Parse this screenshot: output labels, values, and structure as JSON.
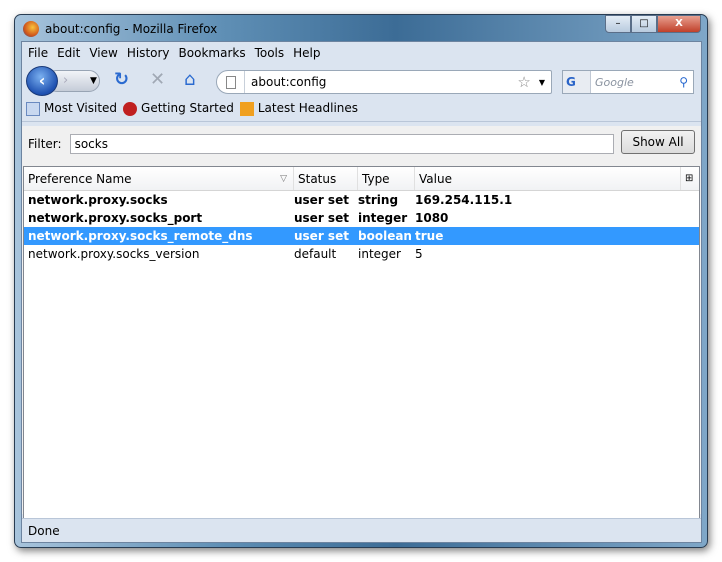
{
  "window": {
    "title": "about:config - Mozilla Firefox",
    "minimize": "–",
    "maximize": "□",
    "close": "X"
  },
  "menu": [
    "File",
    "Edit",
    "View",
    "History",
    "Bookmarks",
    "Tools",
    "Help"
  ],
  "nav": {
    "url": "about:config",
    "search_engine": "G",
    "search_placeholder": "Google"
  },
  "bookmarks": [
    "Most Visited",
    "Getting Started",
    "Latest Headlines"
  ],
  "filter": {
    "label": "Filter:",
    "value": "socks",
    "show_all": "Show All"
  },
  "columns": [
    "Preference Name",
    "Status",
    "Type",
    "Value"
  ],
  "rows": [
    {
      "name": "network.proxy.socks",
      "status": "user set",
      "type": "string",
      "value": "169.254.115.1",
      "style": "bold"
    },
    {
      "name": "network.proxy.socks_port",
      "status": "user set",
      "type": "integer",
      "value": "1080",
      "style": "bold"
    },
    {
      "name": "network.proxy.socks_remote_dns",
      "status": "user set",
      "type": "boolean",
      "value": "true",
      "style": "sel"
    },
    {
      "name": "network.proxy.socks_version",
      "status": "default",
      "type": "integer",
      "value": "5",
      "style": ""
    }
  ],
  "statusbar": "Done"
}
